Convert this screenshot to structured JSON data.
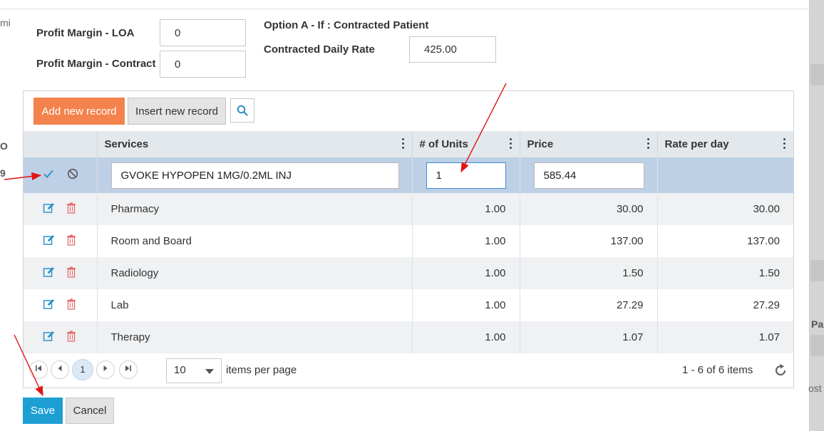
{
  "background": {
    "frag_mi": "mi",
    "frag_o": "O",
    "frag_9": "9",
    "frag_pa": "Pa",
    "frag_ost": "ost"
  },
  "header": {
    "profit_margin_loa_label": "Profit Margin - LOA",
    "profit_margin_loa_value": "0",
    "profit_margin_contract_label": "Profit Margin - Contract",
    "profit_margin_contract_value": "0",
    "option_a_label": "Option A - If : Contracted Patient",
    "contracted_daily_rate_label": "Contracted Daily Rate",
    "contracted_daily_rate_value": "425.00"
  },
  "toolbar": {
    "add_label": "Add new record",
    "insert_label": "Insert new record"
  },
  "columns": {
    "services": "Services",
    "units": "# of Units",
    "price": "Price",
    "rate": "Rate per day"
  },
  "edit_row": {
    "service": "GVOKE HYPOPEN 1MG/0.2ML INJ",
    "units": "1",
    "price": "585.44"
  },
  "rows": [
    {
      "service": "Pharmacy",
      "units": "1.00",
      "price": "30.00",
      "rate": "30.00"
    },
    {
      "service": "Room and Board",
      "units": "1.00",
      "price": "137.00",
      "rate": "137.00"
    },
    {
      "service": "Radiology",
      "units": "1.00",
      "price": "1.50",
      "rate": "1.50"
    },
    {
      "service": "Lab",
      "units": "1.00",
      "price": "27.29",
      "rate": "27.29"
    },
    {
      "service": "Therapy",
      "units": "1.00",
      "price": "1.07",
      "rate": "1.07"
    }
  ],
  "pager": {
    "current_page": "1",
    "page_size": "10",
    "items_per_page_label": "items per page",
    "info": "1 - 6 of 6 items"
  },
  "footer": {
    "save_label": "Save",
    "cancel_label": "Cancel"
  },
  "colors": {
    "add_button": "#f3824c",
    "save_button": "#1e9fd3",
    "edit_row_bg": "#bed0e6",
    "header_bg": "#e3e8ec",
    "edit_icon": "#2e92c9",
    "delete_icon": "#e46d6d",
    "annotation_arrow": "#e01616"
  },
  "icons": {
    "search": "search-icon",
    "update": "checkmark-icon",
    "cancel_edit": "cancel-icon",
    "edit": "edit-icon",
    "delete": "trash-icon",
    "first": "first-page-icon",
    "prev": "prev-page-icon",
    "next": "next-page-icon",
    "last": "last-page-icon",
    "refresh": "refresh-icon",
    "kebab": "kebab-menu-icon"
  }
}
